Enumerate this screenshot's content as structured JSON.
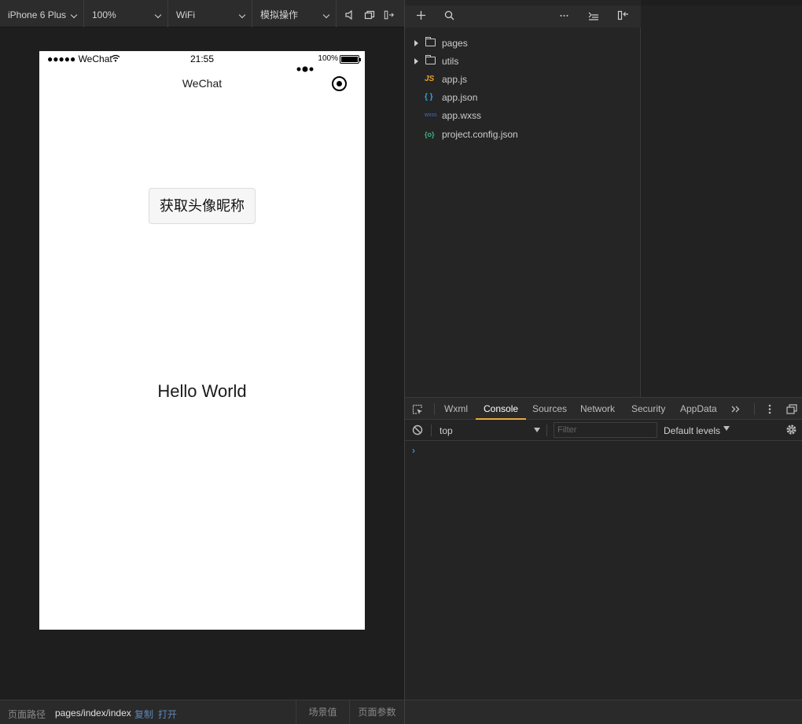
{
  "simulator_toolbar": {
    "device": "iPhone 6 Plus",
    "zoom": "100%",
    "network": "WiFi",
    "operation": "模拟操作"
  },
  "phone": {
    "carrier": "●●●●● WeChat",
    "time": "21:55",
    "battery_percent": "100%",
    "battery_level": 1.0,
    "nav_title": "WeChat",
    "get_profile_button": "获取头像昵称",
    "hello_text": "Hello World"
  },
  "explorer": {
    "items": [
      {
        "label": "pages",
        "type": "folder",
        "icon": "folder-icon"
      },
      {
        "label": "utils",
        "type": "folder",
        "icon": "folder-icon"
      },
      {
        "label": "app.js",
        "type": "file",
        "icon_text": "JS",
        "icon_color": "#e8a22a"
      },
      {
        "label": "app.json",
        "type": "file",
        "icon_text": "{ }",
        "icon_color": "#3aa0d9"
      },
      {
        "label": "app.wxss",
        "type": "file",
        "icon_text": "wxss",
        "icon_color": "#3a72c9"
      },
      {
        "label": "project.config.json",
        "type": "file",
        "icon_text": "{o}",
        "icon_color": "#3fb27f"
      }
    ]
  },
  "devtools": {
    "tabs": [
      "Wxml",
      "Console",
      "Sources",
      "Network",
      "Security",
      "AppData"
    ],
    "active_tab": "Console",
    "context": "top",
    "filter_placeholder": "Filter",
    "levels": "Default levels",
    "prompt": "›"
  },
  "bottom_bar": {
    "path_label": "页面路径",
    "path_value": "pages/index/index",
    "copy_link": "复制",
    "open_link": "打开",
    "scene_label": "场景值",
    "query_label": "页面参数"
  },
  "colors": {
    "accent": "#e7a93b",
    "link": "#5f87b8",
    "background": "#1e1e1e"
  }
}
